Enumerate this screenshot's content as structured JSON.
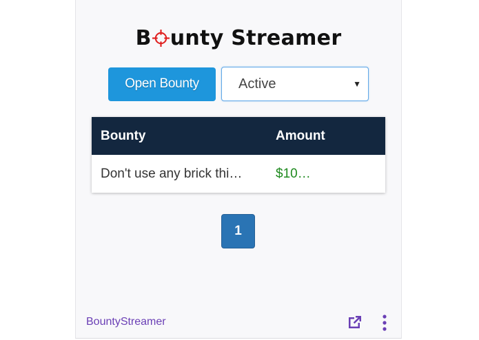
{
  "logo": {
    "prefix": "B",
    "suffix": "unty Streamer",
    "icon": "crosshair-icon"
  },
  "controls": {
    "open_bounty_label": "Open Bounty",
    "status_select": {
      "selected": "Active",
      "icon": "caret-down-icon"
    }
  },
  "table": {
    "headers": {
      "bounty": "Bounty",
      "amount": "Amount"
    },
    "rows": [
      {
        "bounty": "Don't use any brick thi…",
        "amount": "$10…"
      }
    ]
  },
  "pagination": {
    "current_page": "1"
  },
  "footer": {
    "extension_name": "BountyStreamer",
    "popout_icon": "popout-icon",
    "menu_icon": "kebab-menu-icon"
  },
  "colors": {
    "primary_button": "#1e96dc",
    "table_header": "#13273f",
    "amount_text": "#1f8a1f",
    "pager": "#2a74b4",
    "footer_link": "#6a3fb5",
    "crosshair": "#e02020"
  }
}
